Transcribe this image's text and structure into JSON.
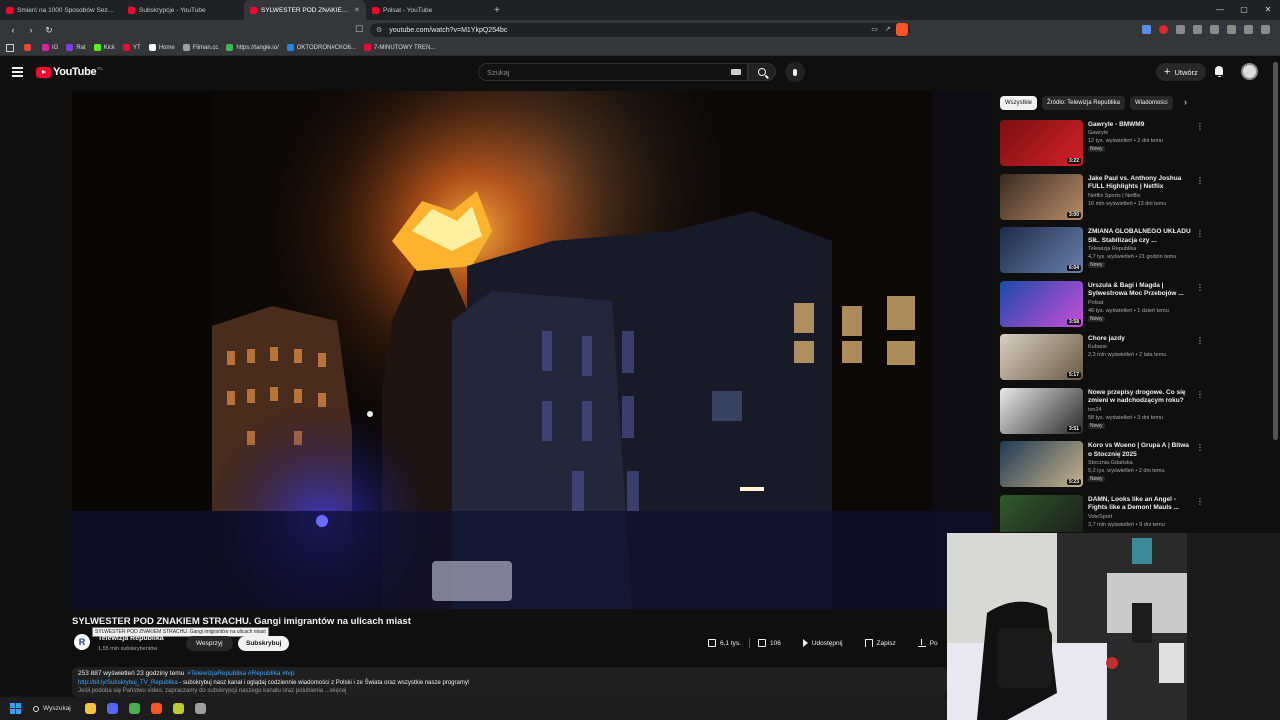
{
  "browser": {
    "tabs": [
      {
        "label": "Śmierć na 1000 Sposobów Sezon 2 O"
      },
      {
        "label": "Subskrypcje - YouTube"
      },
      {
        "label": "SYLWESTER POD ZNAKIEM S"
      },
      {
        "label": "Polsat - YouTube"
      }
    ],
    "new_tab": "+",
    "url": "youtube.com/watch?v=M1YkpQ254bc",
    "bookmarks": [
      {
        "label": "",
        "color": "#e8463b"
      },
      {
        "label": "IG",
        "color": "#d6249f"
      },
      {
        "label": "Rat",
        "color": "#7b3fe4"
      },
      {
        "label": "Kick",
        "color": "#53fc18"
      },
      {
        "label": "YT",
        "color": "#ff0033"
      },
      {
        "label": "Home",
        "color": "#ffffff"
      },
      {
        "label": "Filman.cc",
        "color": "#9aa0a6"
      },
      {
        "label": "https://tangle.io/",
        "color": "#3fb950"
      },
      {
        "label": "OKTODRON#CKO6...",
        "color": "#1e88e5"
      },
      {
        "label": "7-MINUTOWY TREN...",
        "color": "#ff0033"
      }
    ]
  },
  "yt": {
    "logo": "YouTube",
    "country": "PL",
    "search_placeholder": "Szukaj",
    "create_label": "Utwórz",
    "create_plus": "+"
  },
  "video": {
    "title": "SYLWESTER POD ZNAKIEM STRACHU. Gangi imigrantów na ulicach miast",
    "tooltip": "SYLWESTER POD ZNAKIEM STRACHU. Gangi imigrantów na ulicach miast",
    "channel_logo": "R",
    "channel": "Telewizja Republika",
    "subscribers": "1,55 mln subskrybentów",
    "support_label": "Wesprzyj",
    "subscribe_label": "Subskrybuj",
    "likes": "6,1 tys.",
    "dislikes": "106",
    "share_label": "Udostępnij",
    "save_label": "Zapisz",
    "download_label": "Po",
    "views_time": "253 887 wyświetleń  23 godziny temu",
    "hashtags": "#TelewizjaRepublika #Republika #tvp",
    "desc_link": "http://bit.ly/Subskrybuj_TV_Republika",
    "desc_text": " - subskrybuj nasz kanał i oglądaj codziennie wiadomości z Polski i ze Świata oraz wszystkie nasze programy!",
    "desc_more": "Jeśli podoba się Państwu video, zapraszamy do subskrypcji naszego kanału oraz polubienia ...więcej"
  },
  "chips": [
    "Wszystkie",
    "Źródło: Telewizja Republika",
    "Wiadomości"
  ],
  "recommendations": [
    {
      "title": "Gawryle - BMWM9",
      "channel": "Gawryle",
      "meta": "12 tys. wyświetleń • 2 dni temu",
      "badge": "Nowy",
      "duration": "3:22",
      "colors": [
        "#7a1010",
        "#d4202a"
      ]
    },
    {
      "title": "Jake Paul vs. Anthony Joshua FULL Highlights | Netflix",
      "channel": "Netflix Sports  |  Netflix",
      "meta": "16 mln wyświetleń • 13 dni temu",
      "badge": "",
      "duration": "3:00",
      "colors": [
        "#3a2a20",
        "#b98d6a"
      ]
    },
    {
      "title": "ZMIANA GLOBALNEGO UKŁADU SIŁ. Stabilizacja czy ...",
      "channel": "Telewizja Republika",
      "meta": "4,7 tys. wyświetleń • 21 godzin temu",
      "badge": "Nowy",
      "duration": "6:04",
      "colors": [
        "#1d2b4a",
        "#6a7fa8"
      ]
    },
    {
      "title": "Urszula & Bagi i Magda | Sylwestrowa Moc Przebojów ...",
      "channel": "Polsat",
      "meta": "46 tys. wyświetleń • 1 dzień temu",
      "badge": "Nowy",
      "duration": "3:58",
      "colors": [
        "#1a4aa8",
        "#c94fd8"
      ]
    },
    {
      "title": "Chore jazdy",
      "channel": "Kubano",
      "meta": "2,3 mln wyświetleń • 2 lata temu",
      "badge": "",
      "duration": "5:17",
      "colors": [
        "#d8d0c2",
        "#6a5a45"
      ]
    },
    {
      "title": "Nowe przepisy drogowe. Co się zmieni w nadchodzącym roku?",
      "channel": "tvn24",
      "meta": "58 tys. wyświetleń • 3 dni temu",
      "badge": "Nowy",
      "duration": "3:51",
      "colors": [
        "#eaeaea",
        "#2a2a2a"
      ]
    },
    {
      "title": "Koro vs Wueno | Grupa A | Bitwa o Stocznię 2025",
      "channel": "Stocznia Gdańska",
      "meta": "5,2 tys. wyświetleń • 2 dni temu",
      "badge": "Nowy",
      "duration": "5:23",
      "colors": [
        "#1f3a55",
        "#c8b38a"
      ]
    },
    {
      "title": "DAMN, Looks like an Angel - Fights like a Demon! Mauls ...",
      "channel": "VoteSport",
      "meta": "3,7 mln wyświetleń • 9 dni temu",
      "badge": "",
      "duration": "18:14",
      "colors": [
        "#2f5a2a",
        "#1b1b1b"
      ]
    }
  ],
  "taskbar": {
    "search_label": "Wyszukaj",
    "apps": [
      {
        "name": "file-explorer",
        "color": "#f5c542"
      },
      {
        "name": "discord",
        "color": "#5865f2"
      },
      {
        "name": "chrome",
        "color": "#4caf50"
      },
      {
        "name": "brave",
        "color": "#fb542b"
      },
      {
        "name": "app",
        "color": "#c0ca33"
      },
      {
        "name": "settings",
        "color": "#9e9e9e"
      }
    ]
  }
}
